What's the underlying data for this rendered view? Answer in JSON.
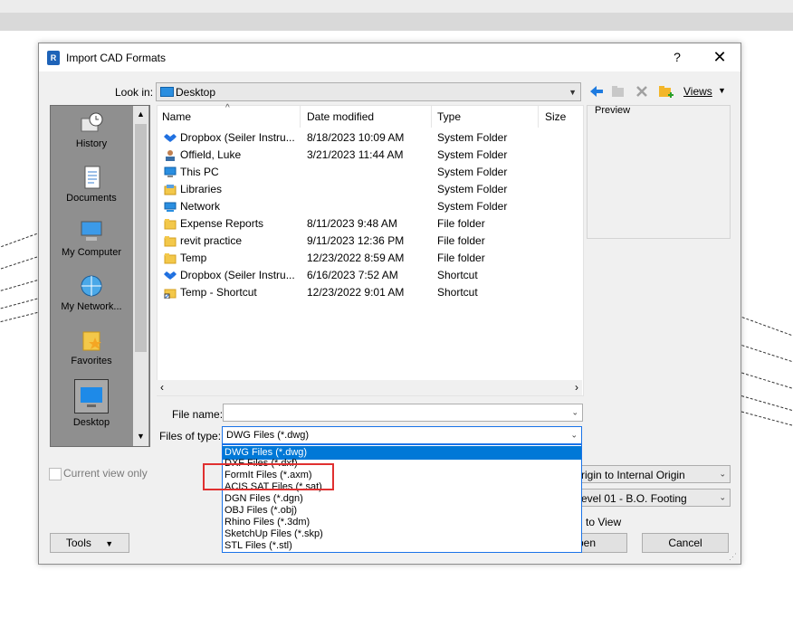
{
  "dialog": {
    "title": "Import CAD Formats",
    "help": "?",
    "close": "✕",
    "app_icon": "R"
  },
  "lookin": {
    "label": "Look in:",
    "value": "Desktop",
    "toolbar": {
      "back_icon": "back-arrow-icon",
      "up_icon": "up-folder-icon",
      "delete_icon": "delete-icon",
      "new_folder_icon": "new-folder-icon",
      "views_label": "Views"
    }
  },
  "places": [
    {
      "label": "History"
    },
    {
      "label": "Documents"
    },
    {
      "label": "My Computer"
    },
    {
      "label": "My Network..."
    },
    {
      "label": "Favorites"
    },
    {
      "label": "Desktop"
    }
  ],
  "columns": [
    "Name",
    "Date modified",
    "Type",
    "Size"
  ],
  "files": [
    {
      "name": "Dropbox (Seiler Instru...",
      "date": "8/18/2023 10:09 AM",
      "type": "System Folder",
      "icon": "dropbox-icon"
    },
    {
      "name": "Offield, Luke",
      "date": "3/21/2023 11:44 AM",
      "type": "System Folder",
      "icon": "user-icon"
    },
    {
      "name": "This PC",
      "date": "",
      "type": "System Folder",
      "icon": "pc-icon"
    },
    {
      "name": "Libraries",
      "date": "",
      "type": "System Folder",
      "icon": "libraries-icon"
    },
    {
      "name": "Network",
      "date": "",
      "type": "System Folder",
      "icon": "network-icon"
    },
    {
      "name": "Expense Reports",
      "date": "8/11/2023 9:48 AM",
      "type": "File folder",
      "icon": "folder-icon"
    },
    {
      "name": "revit practice",
      "date": "9/11/2023 12:36 PM",
      "type": "File folder",
      "icon": "folder-icon"
    },
    {
      "name": "Temp",
      "date": "12/23/2022 8:59 AM",
      "type": "File folder",
      "icon": "folder-icon"
    },
    {
      "name": "Dropbox (Seiler Instru...",
      "date": "6/16/2023 7:52 AM",
      "type": "Shortcut",
      "icon": "dropbox-icon"
    },
    {
      "name": "Temp - Shortcut",
      "date": "12/23/2022 9:01 AM",
      "type": "Shortcut",
      "icon": "shortcut-icon"
    }
  ],
  "preview": {
    "label": "Preview"
  },
  "filename": {
    "label": "File name:",
    "value": ""
  },
  "filetype": {
    "label": "Files of type:",
    "value": "DWG Files  (*.dwg)",
    "options": [
      "DWG Files  (*.dwg)",
      "DXF Files  (*.dxf)",
      "FormIt Files  (*.axm)",
      "ACIS SAT Files  (*.sat)",
      "DGN Files  (*.dgn)",
      "OBJ Files  (*.obj)",
      "Rhino Files  (*.3dm)",
      "SketchUp Files  (*.skp)",
      "STL Files  (*.stl)"
    ]
  },
  "options": {
    "current_view_only": "Current view only",
    "positioning": "rigin to Internal Origin",
    "place_at": "evel 01 - B.O. Footing",
    "orient": "to View"
  },
  "buttons": {
    "tools": "Tools",
    "open": "pen",
    "cancel": "Cancel"
  },
  "colors": {
    "selection": "#0078d7",
    "highlight_box": "#e03030"
  }
}
